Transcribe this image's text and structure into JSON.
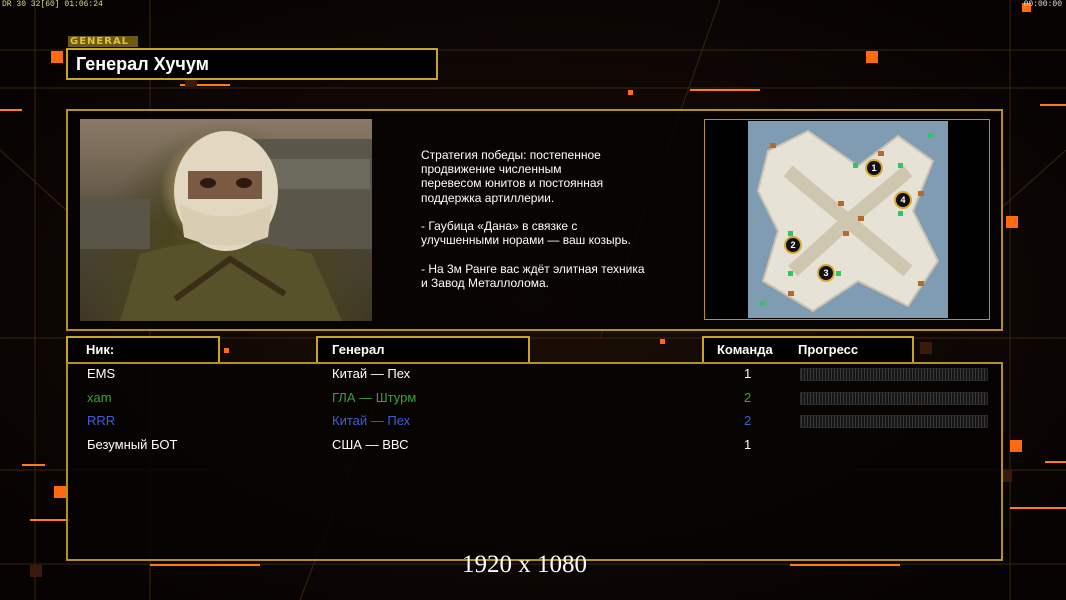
{
  "hud": {
    "top_left": "DR 30 32[60] 01:06:24",
    "top_right": "00:00:00"
  },
  "header": {
    "tag": "GENERAL",
    "title": "Генерал Хучум"
  },
  "description": "Стратегия победы: постепенное\nпродвижение численным\nперевесом юнитов и постоянная\nподдержка артиллерии.\n\n- Гаубица «Дана» в связке с\nулучшенными норами — ваш козырь.\n\n- На 3м Ранге вас ждёт элитная техника\nи Завод Металлолома.",
  "map": {
    "markers": [
      "1",
      "2",
      "3",
      "4"
    ]
  },
  "columns": {
    "nick": "Ник:",
    "general": "Генерал",
    "team": "Команда",
    "progress": "Прогресс"
  },
  "players": [
    {
      "nick": "EMS",
      "general": "Китай — Пех",
      "team": "1",
      "color": "#ffffff",
      "show_progress": true
    },
    {
      "nick": "xam",
      "general": "ГЛА — Штурм",
      "team": "2",
      "color": "#3aa33a",
      "show_progress": true
    },
    {
      "nick": "RRR",
      "general": "Китай — Пех",
      "team": "2",
      "color": "#3f5fd6",
      "show_progress": true
    },
    {
      "nick": "Безумный БОТ",
      "general": "США — ВВС",
      "team": "1",
      "color": "#ffffff",
      "show_progress": false
    }
  ],
  "footer": {
    "resolution": "1920 x 1080"
  },
  "colors": {
    "frame_gold": "#c9a227",
    "accent_orange": "#ff6a10"
  }
}
